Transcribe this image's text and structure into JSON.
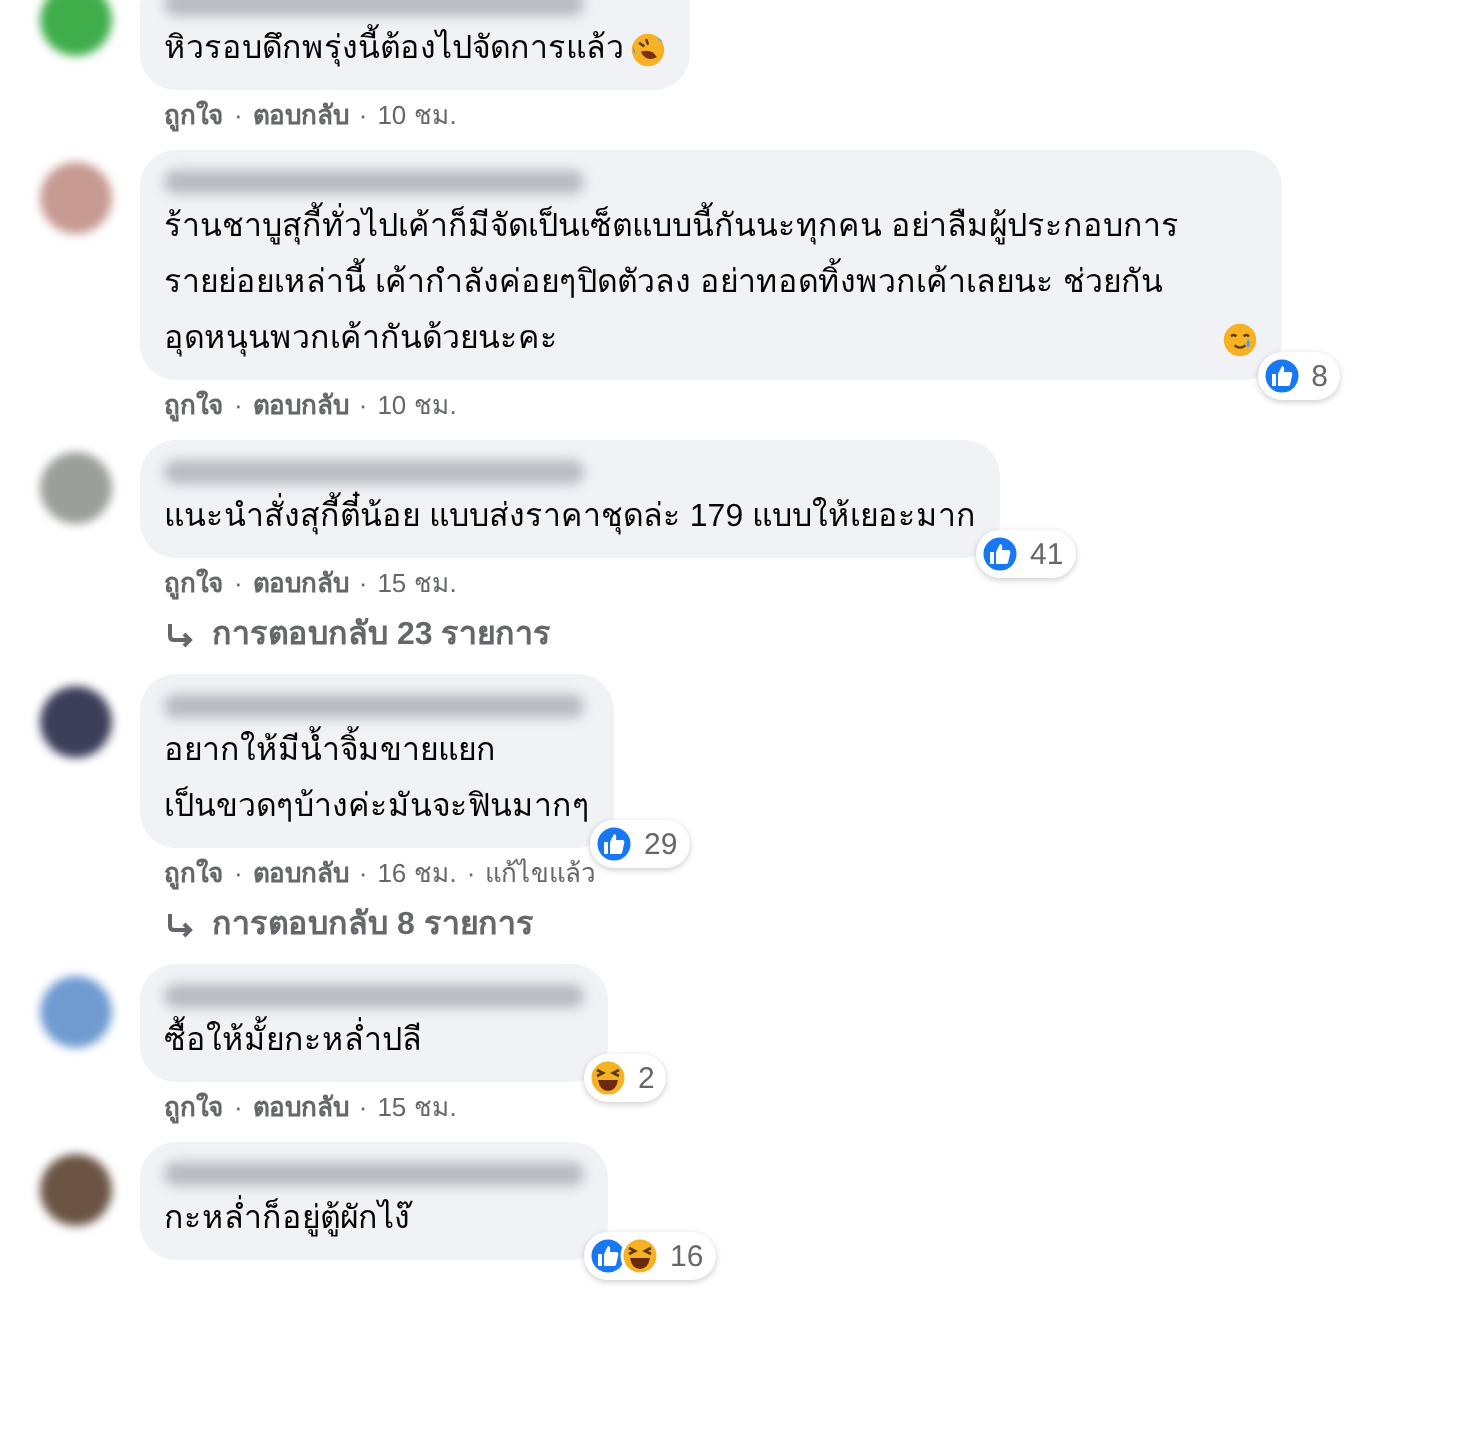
{
  "separator": "·",
  "comments": [
    {
      "avatar": {
        "color": "#3fae4a"
      },
      "text": "หิวรอบดึกพรุ่งนี้ต้องไปจัดการแล้ว",
      "emoji": {
        "kind": "rofl"
      },
      "actions": [
        "ถูกใจ",
        "ตอบกลับ"
      ],
      "time": "10 ชม."
    },
    {
      "avatar": {
        "color": "#c79a92"
      },
      "text": "ร้านชาบูสุกี้ทั่วไปเค้าก็มีจัดเป็นเซ็ตแบบนี้กันนะทุกคน อย่าลืมผู้ประกอบการรายย่อยเหล่านี้ เค้ากำลังค่อยๆปิดตัวลง อย่าทอดทิ้งพวกเค้าเลยนะ ช่วยกันอุดหนุนพวกเค้ากันด้วยนะคะ",
      "emoji": {
        "kind": "tear"
      },
      "reactions": [
        {
          "kind": "like"
        }
      ],
      "reaction_count": "8",
      "actions": [
        "ถูกใจ",
        "ตอบกลับ"
      ],
      "time": "10 ชม."
    },
    {
      "avatar": {
        "color": "#9a9f9a"
      },
      "text": "แนะนำสั่งสุกี้ตี๋น้อย แบบส่งราคาชุดล่ะ 179 แบบให้เยอะมาก",
      "reactions": [
        {
          "kind": "like"
        }
      ],
      "reaction_count": "41",
      "actions": [
        "ถูกใจ",
        "ตอบกลับ"
      ],
      "time": "15 ชม.",
      "replies_link": "การตอบกลับ 23 รายการ"
    },
    {
      "avatar": {
        "color": "#3c3f5a"
      },
      "text": "อยากให้มีน้ำจิ้มขายแยก\nเป็นขวดๆบ้างค่ะมันจะฟินมากๆ",
      "reactions": [
        {
          "kind": "like"
        }
      ],
      "reaction_count": "29",
      "actions": [
        "ถูกใจ",
        "ตอบกลับ"
      ],
      "time": "16 ชม.",
      "edited": "แก้ไขแล้ว",
      "replies_link": "การตอบกลับ 8 รายการ"
    },
    {
      "avatar": {
        "color": "#6f9bd1"
      },
      "text": "ซื้อให้มั้ยกะหล่ำปลี",
      "reactions": [
        {
          "kind": "haha"
        }
      ],
      "reaction_count": "2",
      "actions": [
        "ถูกใจ",
        "ตอบกลับ"
      ],
      "time": "15 ชม."
    },
    {
      "avatar": {
        "color": "#6b5444"
      },
      "text": "กะหล่ำก็อยู่ตู้ผักไง๊",
      "reactions": [
        {
          "kind": "like"
        },
        {
          "kind": "haha"
        }
      ],
      "reaction_count": "16"
    }
  ]
}
